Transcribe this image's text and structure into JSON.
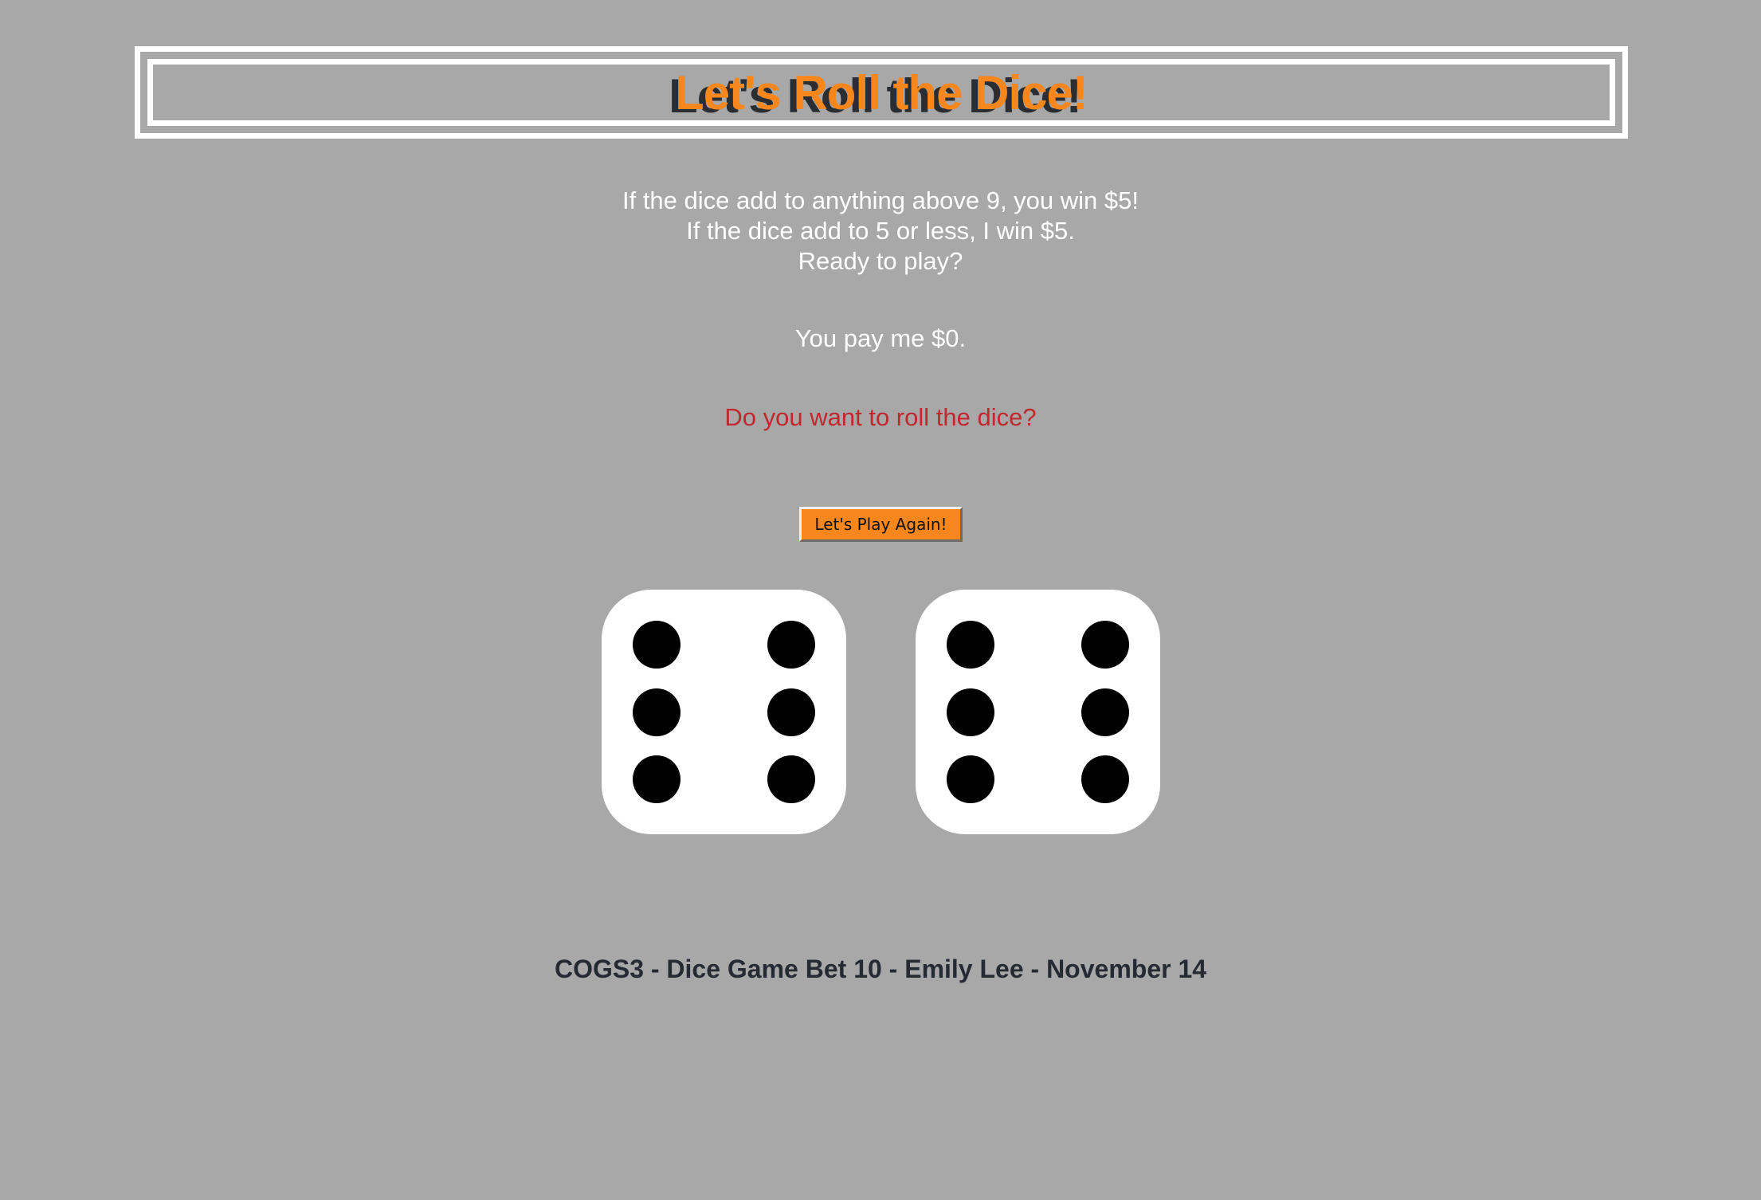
{
  "header": {
    "title": "Let's Roll the Dice!"
  },
  "rules": {
    "line1": "If the dice add to anything above 9, you win $5!",
    "line2": "If the dice add to 5 or less, I win $5.",
    "line3": "Ready to play?"
  },
  "result": {
    "payment_text": "You pay me $0."
  },
  "prompt": {
    "text": "Do you want to roll the dice?"
  },
  "controls": {
    "play_again_label": "Let's Play Again!"
  },
  "dice": [
    {
      "value": 6
    },
    {
      "value": 6
    }
  ],
  "footer": {
    "credit": "COGS3 - Dice Game Bet 10 - Emily Lee - November 14"
  },
  "colors": {
    "background": "#a8a8a8",
    "accent": "#f7861c",
    "prompt": "#c0282e",
    "footer_text": "#262a33"
  }
}
